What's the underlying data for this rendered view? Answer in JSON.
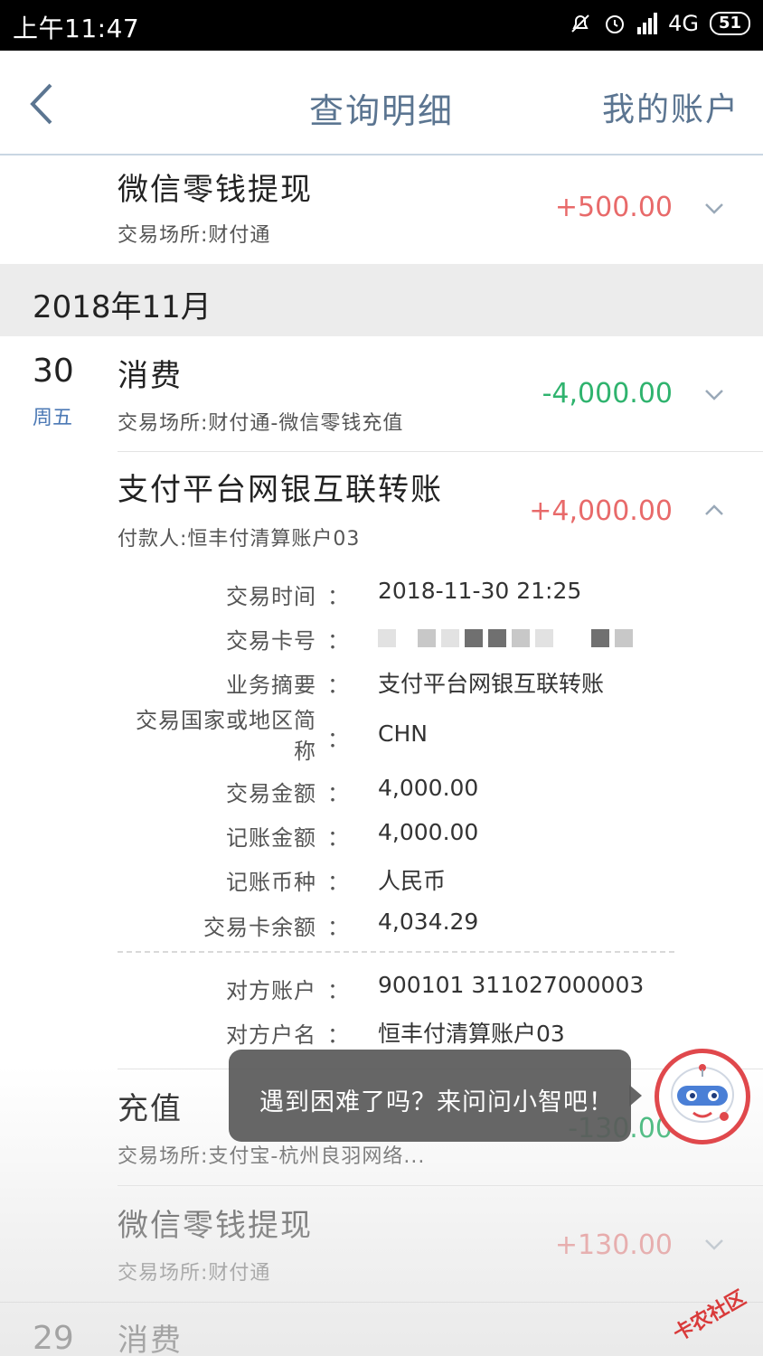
{
  "status_bar": {
    "time": "上午11:47",
    "network": "4G",
    "battery": "51"
  },
  "header": {
    "title": "查询明细",
    "account": "我的账户"
  },
  "transactions": [
    {
      "name": "微信零钱提现",
      "sub": "交易场所:财付通",
      "amount": "+500.00"
    },
    {
      "name": "消费",
      "sub": "交易场所:财付通-微信零钱充值",
      "amount": "-4,000.00",
      "day": "30",
      "weekday": "周五"
    },
    {
      "name": "支付平台网银互联转账",
      "sub": "付款人:恒丰付清算账户03",
      "amount": "+4,000.00"
    },
    {
      "name": "充值",
      "sub": "交易场所:支付宝-杭州良羽网络...",
      "amount": "-130.00"
    },
    {
      "name": "微信零钱提现",
      "sub": "交易场所:财付通",
      "amount": "+130.00"
    },
    {
      "name": "消费",
      "day": "29"
    }
  ],
  "month": "2018年11月",
  "details": [
    {
      "label": "交易时间",
      "value": "2018-11-30 21:25"
    },
    {
      "label": "交易卡号",
      "value": ""
    },
    {
      "label": "业务摘要",
      "value": "支付平台网银互联转账"
    },
    {
      "label": "交易国家或地区简称",
      "value": "CHN"
    },
    {
      "label": "交易金额",
      "value": "4,000.00"
    },
    {
      "label": "记账金额",
      "value": "4,000.00"
    },
    {
      "label": "记账币种",
      "value": "人民币"
    },
    {
      "label": "交易卡余额",
      "value": "4,034.29"
    },
    {
      "label": "对方账户",
      "value": "900101 311027000003"
    },
    {
      "label": "对方户名",
      "value": "恒丰付清算账户03"
    }
  ],
  "colon": "：",
  "tooltip": "遇到困难了吗？来问问小智吧！",
  "watermark": "卡农社区",
  "colors": {
    "positive": "#e86a6a",
    "negative": "#2fb36e",
    "header_text": "#5b7591",
    "weekday": "#4c79b5"
  }
}
